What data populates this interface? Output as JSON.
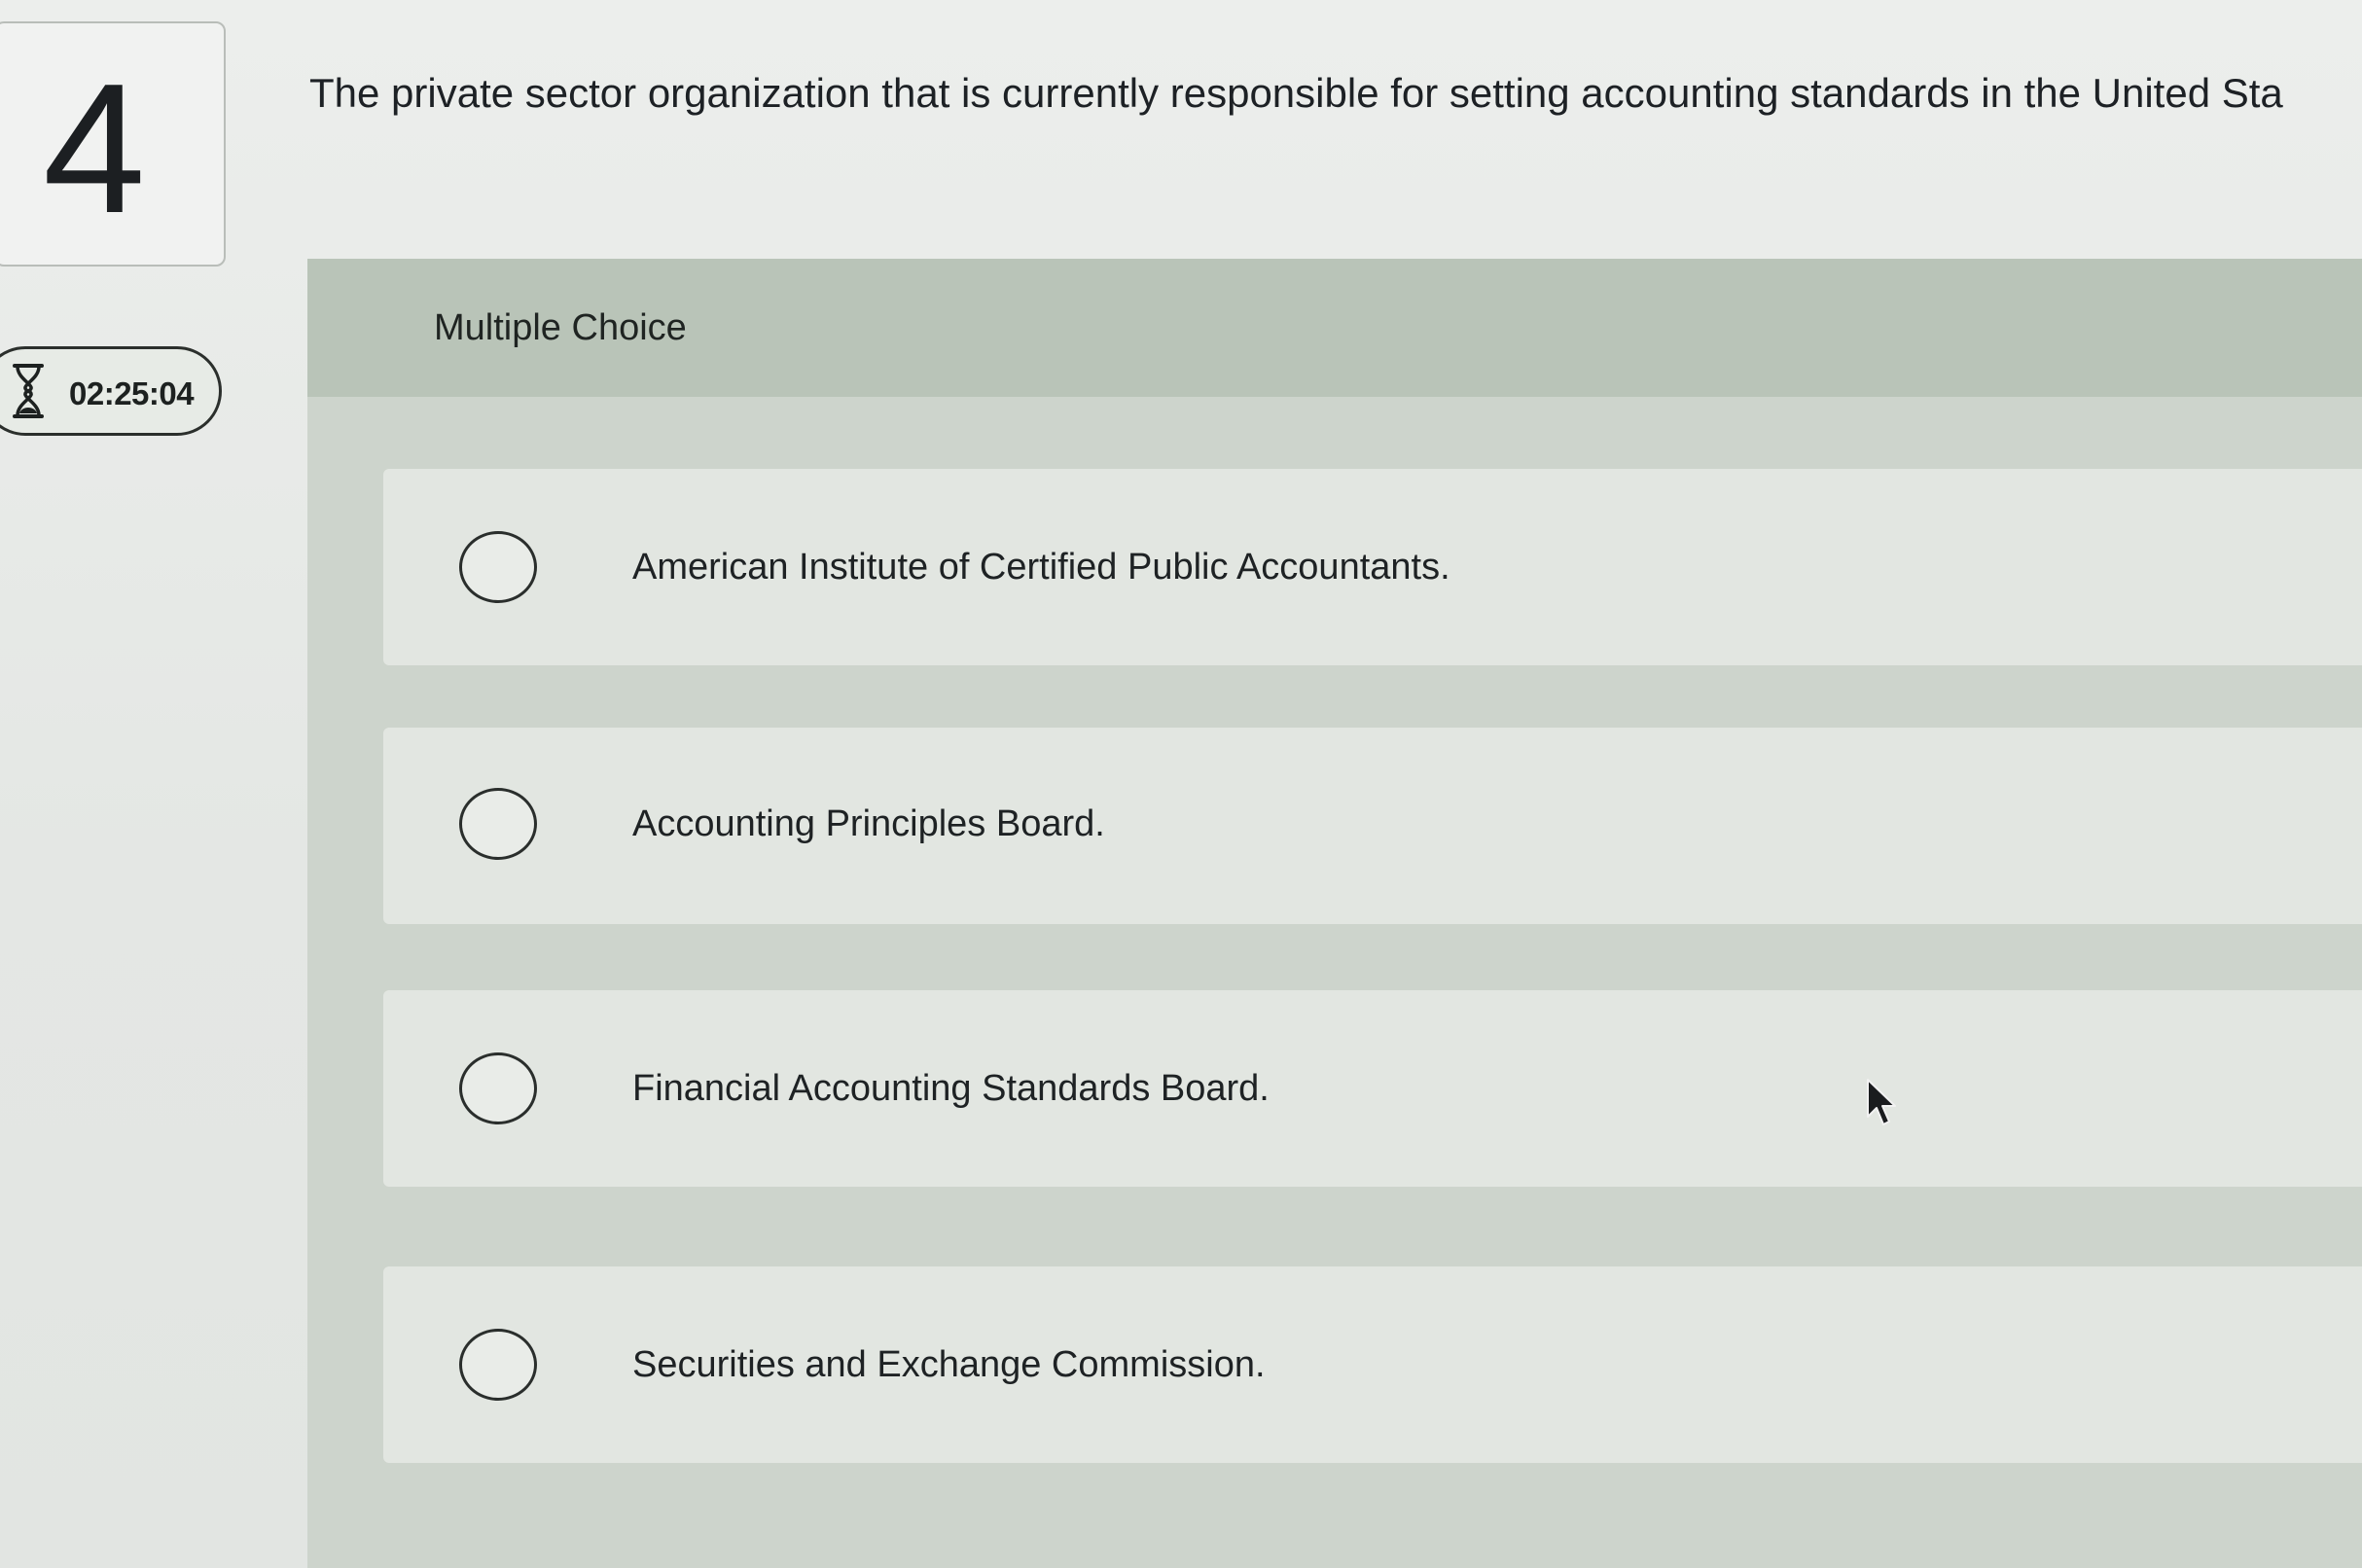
{
  "question": {
    "number": "4",
    "text": "The private sector organization that is currently responsible for setting accounting standards in the United Sta"
  },
  "timer": {
    "icon": "hourglass-icon",
    "value": "02:25:04"
  },
  "panel": {
    "header": "Multiple Choice"
  },
  "options": [
    {
      "label": "American Institute of Certified Public Accountants.",
      "selected": false
    },
    {
      "label": "Accounting Principles Board.",
      "selected": false
    },
    {
      "label": "Financial Accounting Standards Board.",
      "selected": false
    },
    {
      "label": "Securities and Exchange Commission.",
      "selected": false
    }
  ],
  "colors": {
    "panel_header": "#b9c4b8",
    "panel_body": "#cdd4cc",
    "option_bg": "#e2e6e1"
  }
}
